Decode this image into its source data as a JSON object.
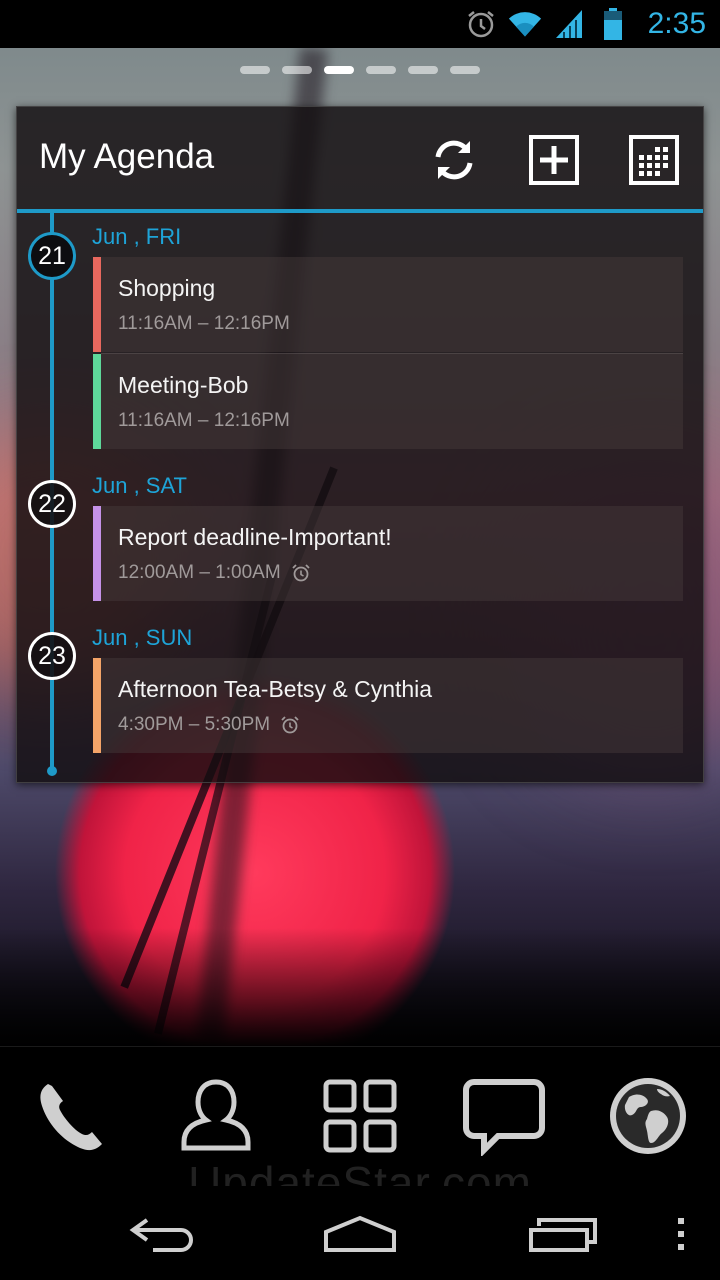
{
  "status_bar": {
    "time": "2:35",
    "icons": [
      "alarm-icon",
      "wifi-icon",
      "signal-icon",
      "battery-icon"
    ],
    "accent_color": "#33b5e5"
  },
  "home": {
    "page_count": 6,
    "active_page": 3
  },
  "widget": {
    "title": "My Agenda",
    "header_buttons": [
      "refresh-icon",
      "add-event-icon",
      "calendar-grid-icon"
    ],
    "accent_color": "#1e9ac8",
    "days": [
      {
        "day_number": "21",
        "label": "Jun , FRI",
        "today": true,
        "events": [
          {
            "title": "Shopping",
            "time": "11:16AM – 12:16PM",
            "color": "#e8685e",
            "alarm": false
          },
          {
            "title": "Meeting-Bob",
            "time": "11:16AM – 12:16PM",
            "color": "#5ed89a",
            "alarm": false
          }
        ]
      },
      {
        "day_number": "22",
        "label": "Jun , SAT",
        "today": false,
        "events": [
          {
            "title": "Report deadline-Important!",
            "time": "12:00AM – 1:00AM",
            "color": "#c592e8",
            "alarm": true
          }
        ]
      },
      {
        "day_number": "23",
        "label": "Jun , SUN",
        "today": false,
        "events": [
          {
            "title": "Afternoon Tea-Betsy & Cynthia",
            "time": "4:30PM – 5:30PM",
            "color": "#f4a468",
            "alarm": true
          }
        ]
      }
    ]
  },
  "dock": {
    "items": [
      "phone-icon",
      "contacts-icon",
      "apps-icon",
      "messaging-icon",
      "browser-globe-icon"
    ]
  },
  "watermark": "UpdateStar.com",
  "nav_bar": {
    "buttons": [
      "back-icon",
      "home-icon",
      "recent-apps-icon",
      "overflow-menu-icon"
    ]
  }
}
